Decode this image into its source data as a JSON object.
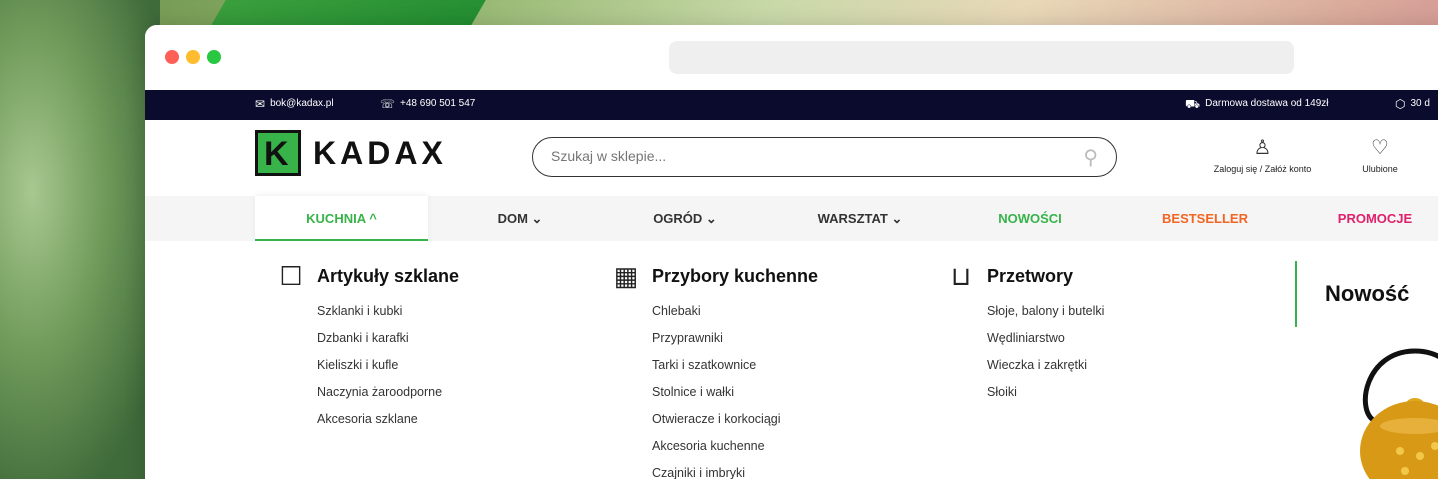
{
  "topbar": {
    "email": "bok@kadax.pl",
    "phone": "+48 690 501 547",
    "shipping": "Darmowa dostawa od 149zł",
    "returns": "30 d"
  },
  "header": {
    "logo_text": "KADAX",
    "search_placeholder": "Szukaj w sklepie...",
    "account_label": "Zaloguj się / Załóż konto",
    "favorites_label": "Ulubione"
  },
  "nav": {
    "tabs": [
      {
        "label": "KUCHNIA ^",
        "color": "#37b34a"
      },
      {
        "label": "DOM ⌄",
        "color": "#333333"
      },
      {
        "label": "OGRÓD ⌄",
        "color": "#333333"
      },
      {
        "label": "WARSZTAT ⌄",
        "color": "#333333"
      },
      {
        "label": "NOWOŚCI",
        "color": "#37b34a"
      },
      {
        "label": "BESTSELLER",
        "color": "#f26522"
      },
      {
        "label": "PROMOCJE",
        "color": "#e0206b"
      }
    ]
  },
  "menu": {
    "columns": [
      {
        "title": "Artykuły szklane",
        "icon": "mug-icon",
        "items": [
          "Szklanki i kubki",
          "Dzbanki i karafki",
          "Kieliszki i kufle",
          "Naczynia żaroodporne",
          "Akcesoria szklane"
        ]
      },
      {
        "title": "Przybory kuchenne",
        "icon": "grater-icon",
        "items": [
          "Chlebaki",
          "Przyprawniki",
          "Tarki i szatkownice",
          "Stolnice i wałki",
          "Otwieracze i korkociągi",
          "Akcesoria kuchenne",
          "Czajniki i imbryki"
        ]
      },
      {
        "title": "Przetwory",
        "icon": "jar-icon",
        "items": [
          "Słoje, balony i butelki",
          "Wędliniarstwo",
          "Wieczka i zakrętki",
          "Słoiki"
        ]
      }
    ],
    "new_title": "Nowość"
  }
}
